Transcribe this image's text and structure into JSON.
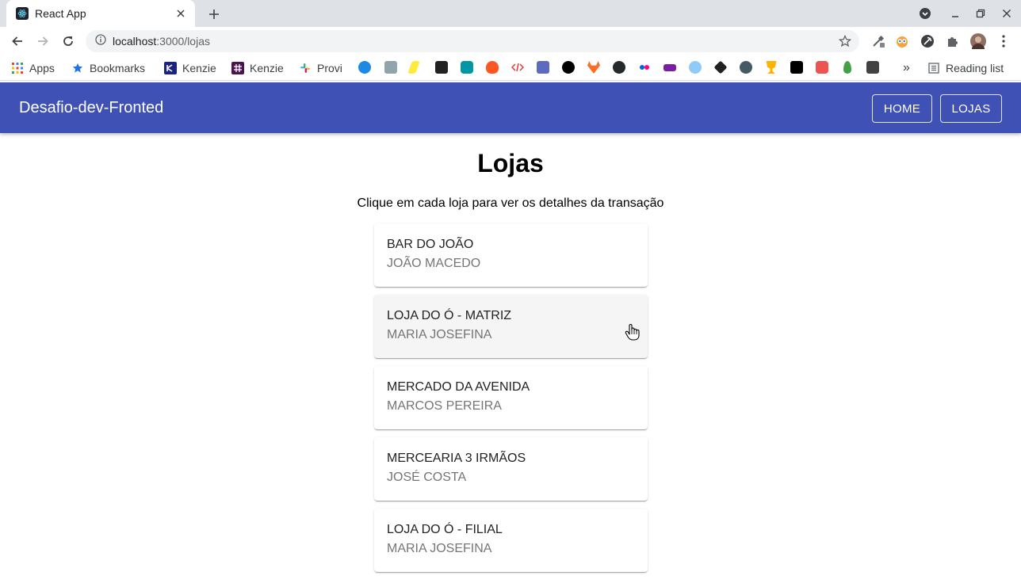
{
  "browser": {
    "tab_title": "React App",
    "url_host": "localhost",
    "url_path": ":3000/lojas"
  },
  "bookmarks": {
    "apps": "Apps",
    "bookmarks": "Bookmarks",
    "kenzie1": "Kenzie",
    "kenzie2": "Kenzie",
    "provi": "Provi",
    "overflow": "»",
    "reading_list": "Reading list"
  },
  "appbar": {
    "title": "Desafio-dev-Fronted",
    "home_label": "HOME",
    "lojas_label": "LOJAS",
    "color": "#3f51b5"
  },
  "main": {
    "heading": "Lojas",
    "subtitle": "Clique em cada loja para ver os detalhes da transação",
    "stores": [
      {
        "name": "BAR DO JOÃO",
        "owner": "JOÃO MACEDO"
      },
      {
        "name": "LOJA DO Ó - MATRIZ",
        "owner": "MARIA JOSEFINA"
      },
      {
        "name": "MERCADO DA AVENIDA",
        "owner": "MARCOS PEREIRA"
      },
      {
        "name": "MERCEARIA 3 IRMÃOS",
        "owner": "JOSÉ COSTA"
      },
      {
        "name": "LOJA DO Ó - FILIAL",
        "owner": "MARIA JOSEFINA"
      }
    ]
  }
}
